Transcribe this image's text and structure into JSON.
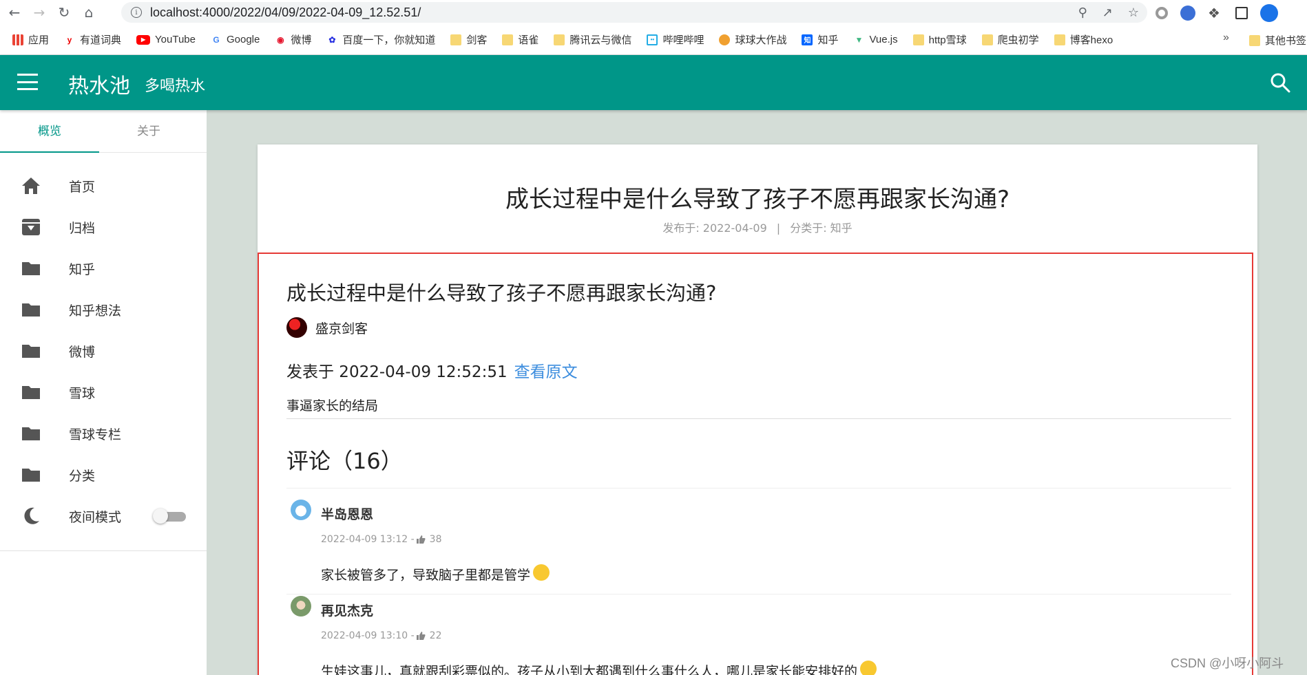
{
  "browser": {
    "url": "localhost:4000/2022/04/09/2022-04-09_12.52.51/",
    "bookmarks": [
      {
        "label": "应用",
        "icon": "apps-grid-icon"
      },
      {
        "label": "有道词典",
        "icon": "youdao-icon"
      },
      {
        "label": "YouTube",
        "icon": "youtube-icon"
      },
      {
        "label": "Google",
        "icon": "google-icon"
      },
      {
        "label": "微博",
        "icon": "weibo-icon"
      },
      {
        "label": "百度一下，你就知道",
        "icon": "baidu-icon"
      },
      {
        "label": "剑客",
        "icon": "folder-icon"
      },
      {
        "label": "语雀",
        "icon": "folder-icon"
      },
      {
        "label": "腾讯云与微信",
        "icon": "folder-icon"
      },
      {
        "label": "哔哩哔哩",
        "icon": "bilibili-icon"
      },
      {
        "label": "球球大作战",
        "icon": "game-icon"
      },
      {
        "label": "知乎",
        "icon": "zhihu-icon"
      },
      {
        "label": "Vue.js",
        "icon": "vue-icon"
      },
      {
        "label": "http雪球",
        "icon": "folder-icon"
      },
      {
        "label": "爬虫初学",
        "icon": "folder-icon"
      },
      {
        "label": "博客hexo",
        "icon": "folder-icon"
      }
    ],
    "more_label": "»",
    "other_bookmarks": "其他书签"
  },
  "header": {
    "title": "热水池",
    "subtitle": "多喝热水"
  },
  "sidebar": {
    "tabs": [
      "概览",
      "关于"
    ],
    "items": [
      {
        "label": "首页",
        "icon": "home-icon"
      },
      {
        "label": "归档",
        "icon": "archive-icon"
      },
      {
        "label": "知乎",
        "icon": "folder-icon"
      },
      {
        "label": "知乎想法",
        "icon": "folder-icon"
      },
      {
        "label": "微博",
        "icon": "folder-icon"
      },
      {
        "label": "雪球",
        "icon": "folder-icon"
      },
      {
        "label": "雪球专栏",
        "icon": "folder-icon"
      },
      {
        "label": "分类",
        "icon": "folder-icon"
      },
      {
        "label": "夜间模式",
        "icon": "moon-icon"
      }
    ]
  },
  "post": {
    "title": "成长过程中是什么导致了孩子不愿再跟家长沟通?",
    "published_label": "发布于: 2022-04-09",
    "meta_separator": "|",
    "category_label": "分类于: 知乎",
    "inner_title": "成长过程中是什么导致了孩子不愿再跟家长沟通?",
    "author": "盛京剑客",
    "pub_time": "发表于 2022-04-09 12:52:51",
    "source_link": "查看原文",
    "excerpt": "事逼家长的结局",
    "comments_title": "评论（16）"
  },
  "comments": [
    {
      "author": "半岛恩恩",
      "time": "2022-04-09 13:12 -",
      "likes": "38",
      "text": "家长被管多了，导致脑子里都是管学",
      "avatar_color": "#6ab4e8"
    },
    {
      "author": "再见杰克",
      "time": "2022-04-09 13:10 -",
      "likes": "22",
      "text": "生娃这事儿，真就跟刮彩票似的。孩子从小到大都遇到什么事什么人，哪儿是家长能安排好的",
      "avatar_color": "#7a9a6a"
    }
  ],
  "watermark": "CSDN @小呀小阿斗",
  "colors": {
    "primary": "#009688",
    "accent_link": "#3c8dde",
    "highlight_box": "#e53935"
  }
}
